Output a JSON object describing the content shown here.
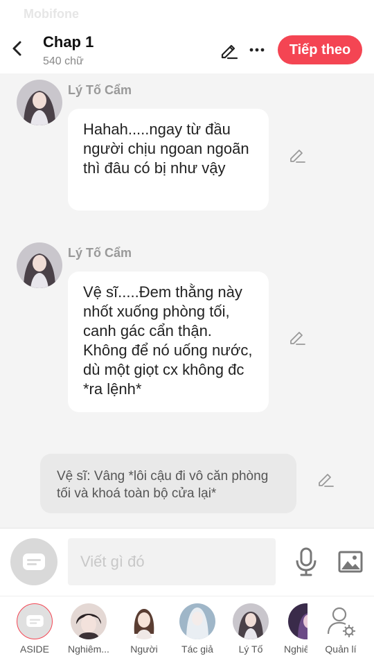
{
  "status_bar": {
    "carrier": "Mobifone"
  },
  "header": {
    "title": "Chap 1",
    "word_count": "540 chữ",
    "next_label": "Tiếp theo",
    "accent_color": "#f44553"
  },
  "messages": [
    {
      "author": "Lý Tố Cẩm",
      "text": "Hahah.....ngay từ đầu người chịu ngoan ngoãn thì đâu có bị như vậy"
    },
    {
      "author": "Lý Tố Cẩm",
      "text": "Vệ sĩ.....Đem thằng này nhốt xuống phòng tối, canh gác cẩn thận. Không để nó uống nước, dù một giọt cx không đc *ra lệnh*"
    }
  ],
  "narration": {
    "text": "Vệ sĩ: Vâng *lôi cậu đi vô căn phòng tối và khoá toàn bộ cửa lại*"
  },
  "composer": {
    "placeholder": "Viết gì đó"
  },
  "characters": [
    {
      "label": "ASIDE",
      "icon": "chat-bubble-icon"
    },
    {
      "label": "Nghiêm...",
      "icon": "avatar"
    },
    {
      "label": "Người",
      "icon": "avatar"
    },
    {
      "label": "Tác giả",
      "icon": "avatar"
    },
    {
      "label": "Lý Tố",
      "icon": "avatar"
    },
    {
      "label": "Nghiê",
      "icon": "avatar"
    },
    {
      "label": "Quản lí",
      "icon": "user-settings-icon"
    }
  ]
}
